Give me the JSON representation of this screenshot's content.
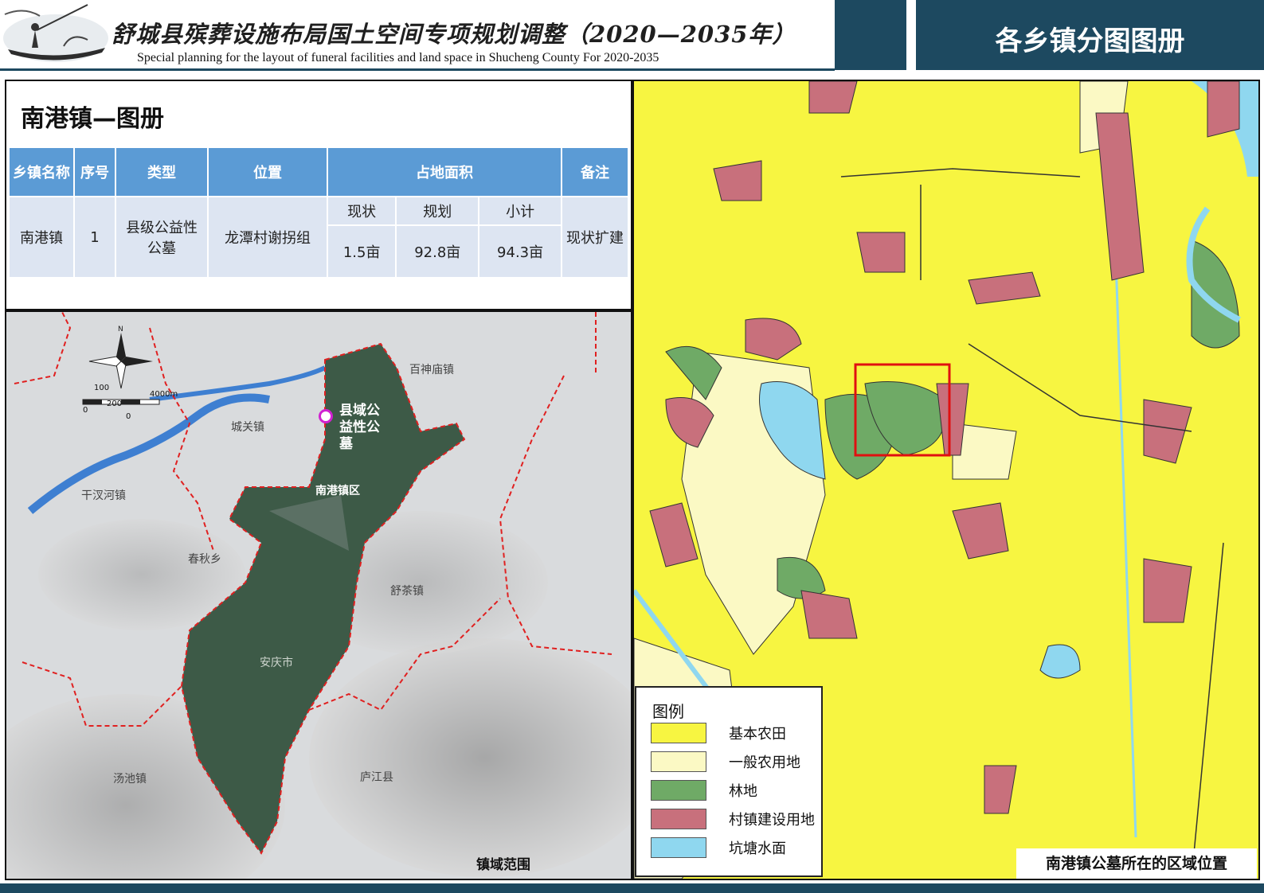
{
  "header": {
    "title_cn": "舒城县殡葬设施布局国土空间专项规划调整（2020—2035年）",
    "title_en": "Special planning for the layout of funeral facilities and land space in Shucheng County For 2020-2035",
    "section": "各乡镇分图图册"
  },
  "info": {
    "town_title": "南港镇—图册",
    "table": {
      "headers": [
        "乡镇名称",
        "序号",
        "类型",
        "位置",
        "占地面积",
        "备注"
      ],
      "sub_headers": [
        "现状",
        "规划",
        "小计"
      ],
      "row": {
        "town": "南港镇",
        "index": "1",
        "type": "县级公益性公墓",
        "location": "龙潭村谢拐组",
        "area_current": "1.5亩",
        "area_planned": "92.8亩",
        "area_total": "94.3亩",
        "note": "现状扩建"
      }
    }
  },
  "left_map": {
    "compass": "N",
    "scale": {
      "labels_top": [
        "100",
        "4000m"
      ],
      "labels_bottom": [
        "0",
        "200",
        "0"
      ]
    },
    "site_label": "县域公益性公墓",
    "place_labels": [
      "百神庙镇",
      "城关镇",
      "干汊河镇",
      "春秋乡",
      "舒茶镇",
      "南港镇区",
      "安庆市",
      "汤池镇",
      "庐江县"
    ],
    "caption": "镇域范围"
  },
  "right_map": {
    "legend": {
      "title": "图例",
      "items": [
        {
          "label": "基本农田",
          "color": "#f7f541"
        },
        {
          "label": "一般农用地",
          "color": "#fbf9c4"
        },
        {
          "label": "林地",
          "color": "#6faa66"
        },
        {
          "label": "村镇建设用地",
          "color": "#c8707c"
        },
        {
          "label": "坑塘水面",
          "color": "#8fd7ef"
        }
      ]
    },
    "caption": "南港镇公墓所在的区域位置"
  }
}
